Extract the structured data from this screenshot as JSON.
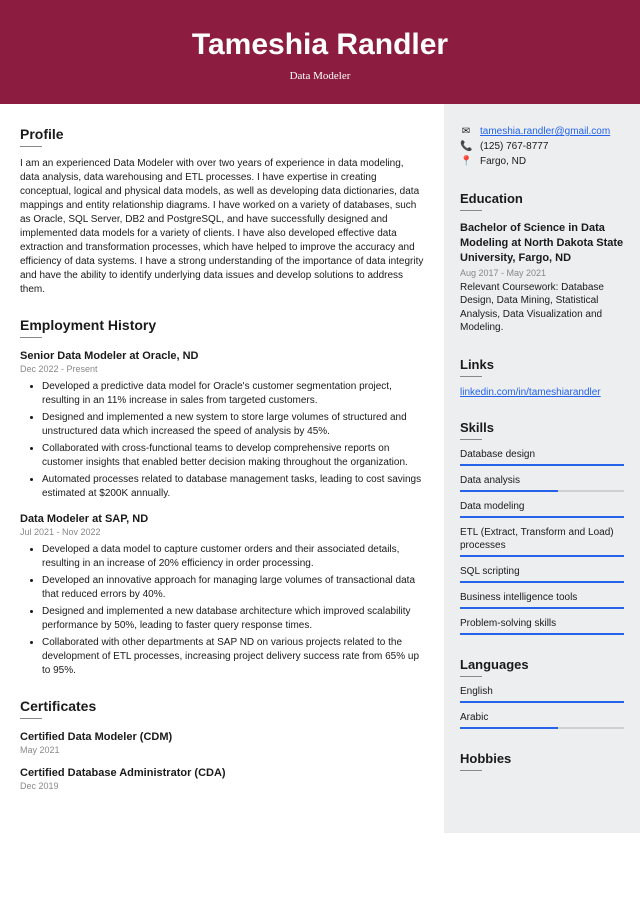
{
  "header": {
    "name": "Tameshia Randler",
    "title": "Data Modeler"
  },
  "profile": {
    "title": "Profile",
    "text": "I am an experienced Data Modeler with over two years of experience in data modeling, data analysis, data warehousing and ETL processes. I have expertise in creating conceptual, logical and physical data models, as well as developing data dictionaries, data mappings and entity relationship diagrams. I have worked on a variety of databases, such as Oracle, SQL Server, DB2 and PostgreSQL, and have successfully designed and implemented data models for a variety of clients. I have also developed effective data extraction and transformation processes, which have helped to improve the accuracy and efficiency of data systems. I have a strong understanding of the importance of data integrity and have the ability to identify underlying data issues and develop solutions to address them."
  },
  "employment": {
    "title": "Employment History",
    "jobs": [
      {
        "title": "Senior Data Modeler at Oracle, ND",
        "dates": "Dec 2022 - Present",
        "bullets": [
          "Developed a predictive data model for Oracle's customer segmentation project, resulting in an 11% increase in sales from targeted customers.",
          "Designed and implemented a new system to store large volumes of structured and unstructured data which increased the speed of analysis by 45%.",
          "Collaborated with cross-functional teams to develop comprehensive reports on customer insights that enabled better decision making throughout the organization.",
          "Automated processes related to database management tasks, leading to cost savings estimated at $200K annually."
        ]
      },
      {
        "title": "Data Modeler at SAP, ND",
        "dates": "Jul 2021 - Nov 2022",
        "bullets": [
          "Developed a data model to capture customer orders and their associated details, resulting in an increase of 20% efficiency in order processing.",
          "Developed an innovative approach for managing large volumes of transactional data that reduced errors by 40%.",
          "Designed and implemented a new database architecture which improved scalability performance by 50%, leading to faster query response times.",
          "Collaborated with other departments at SAP ND on various projects related to the development of ETL processes, increasing project delivery success rate from 65% up to 95%."
        ]
      }
    ]
  },
  "certificates": {
    "title": "Certificates",
    "items": [
      {
        "name": "Certified Data Modeler (CDM)",
        "date": "May 2021"
      },
      {
        "name": "Certified Database Administrator (CDA)",
        "date": "Dec 2019"
      }
    ]
  },
  "contact": {
    "email": "tameshia.randler@gmail.com",
    "phone": "(125) 767-8777",
    "location": "Fargo, ND"
  },
  "education": {
    "title": "Education",
    "degree": "Bachelor of Science in Data Modeling at North Dakota State University, Fargo, ND",
    "dates": "Aug 2017 - May 2021",
    "desc": "Relevant Coursework: Database Design, Data Mining, Statistical Analysis, Data Visualization and Modeling."
  },
  "links": {
    "title": "Links",
    "url": "linkedin.com/in/tameshiarandler"
  },
  "skills": {
    "title": "Skills",
    "items": [
      {
        "name": "Database design",
        "level": 100
      },
      {
        "name": "Data analysis",
        "level": 60
      },
      {
        "name": "Data modeling",
        "level": 100
      },
      {
        "name": "ETL (Extract, Transform and Load) processes",
        "level": 100
      },
      {
        "name": "SQL scripting",
        "level": 100
      },
      {
        "name": "Business intelligence tools",
        "level": 100
      },
      {
        "name": "Problem-solving skills",
        "level": 100
      }
    ]
  },
  "languages": {
    "title": "Languages",
    "items": [
      {
        "name": "English",
        "level": 100
      },
      {
        "name": "Arabic",
        "level": 60
      }
    ]
  },
  "hobbies": {
    "title": "Hobbies"
  }
}
